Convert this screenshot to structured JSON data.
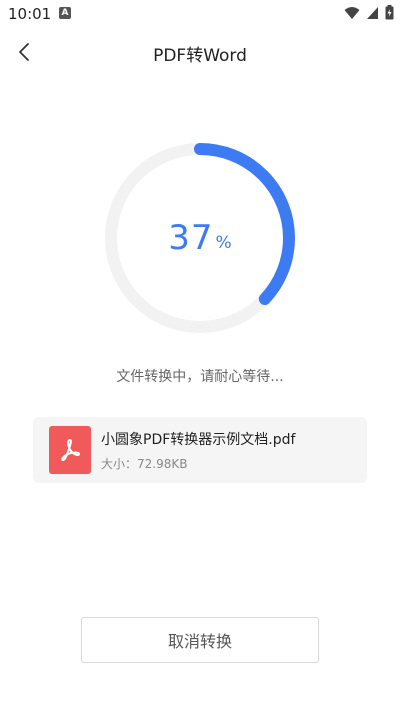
{
  "status_bar": {
    "time": "10:01",
    "notification_icon": "a-icon",
    "icons": [
      "wifi-icon",
      "signal-icon",
      "battery-icon"
    ]
  },
  "header": {
    "back_icon": "chevron-left-icon",
    "title": "PDF转Word"
  },
  "progress": {
    "value": 37,
    "unit": "%",
    "fraction": 0.37,
    "message": "文件转换中，请耐心等待...",
    "track_color": "#f2f2f2",
    "fill_color": "#3d7bf2"
  },
  "file": {
    "icon": "pdf-icon",
    "name": "小圆象PDF转换器示例文档.pdf",
    "size_text": "大小：72.98KB",
    "icon_color": "#f05a5a"
  },
  "actions": {
    "cancel_label": "取消转换"
  }
}
